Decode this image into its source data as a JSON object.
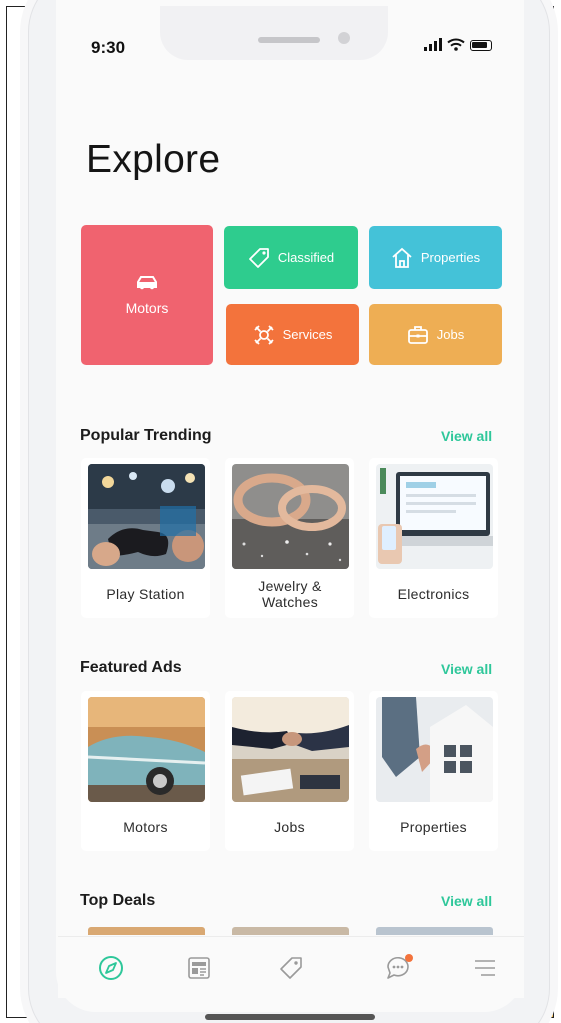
{
  "status": {
    "time": "9:30"
  },
  "header": {
    "title": "Explore"
  },
  "categories": [
    {
      "label": "Motors",
      "icon": "car-icon",
      "color": "#f0636f"
    },
    {
      "label": "Classified",
      "icon": "tag-icon",
      "color": "#2ecc8e"
    },
    {
      "label": "Properties",
      "icon": "house-icon",
      "color": "#44c2d8"
    },
    {
      "label": "Services",
      "icon": "services-icon",
      "color": "#f3733c"
    },
    {
      "label": "Jobs",
      "icon": "briefcase-icon",
      "color": "#eeae54"
    }
  ],
  "popular": {
    "title": "Popular Trending",
    "view_all": "View all",
    "items": [
      {
        "label": "Play Station"
      },
      {
        "label": "Jewelry & Watches"
      },
      {
        "label": "Electronics"
      }
    ]
  },
  "featured": {
    "title": "Featured Ads",
    "view_all": "View all",
    "items": [
      {
        "label": "Motors"
      },
      {
        "label": "Jobs"
      },
      {
        "label": "Properties"
      }
    ]
  },
  "deals": {
    "title": "Top Deals",
    "view_all": "View all"
  },
  "tabbar": {
    "items": [
      {
        "icon": "compass-icon",
        "active": true
      },
      {
        "icon": "newspaper-icon",
        "active": false
      },
      {
        "icon": "tag-icon",
        "active": false
      },
      {
        "icon": "chat-icon",
        "active": false,
        "badge": true
      },
      {
        "icon": "menu-icon",
        "active": false
      }
    ]
  },
  "colors": {
    "accent": "#2ec79a",
    "side_strip": "#efb53f",
    "badge": "#f3733c"
  }
}
